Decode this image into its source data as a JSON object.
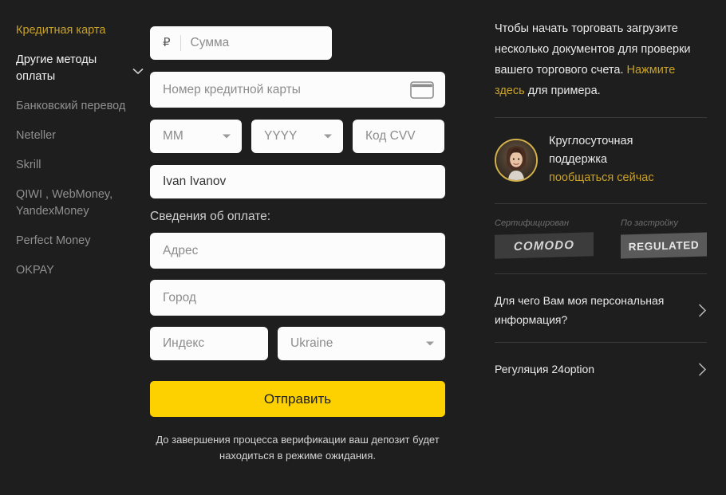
{
  "sidebar": {
    "items": [
      {
        "label": "Кредитная карта",
        "state": "active"
      },
      {
        "label": "Другие методы оплаты",
        "state": "bright",
        "icon": "chevron-down-icon"
      },
      {
        "label": "Банковский перевод",
        "state": "normal"
      },
      {
        "label": "Neteller",
        "state": "normal"
      },
      {
        "label": "Skrill",
        "state": "normal"
      },
      {
        "label": "QIWI , WebMoney, YandexMoney",
        "state": "normal"
      },
      {
        "label": "Perfect Money",
        "state": "normal"
      },
      {
        "label": "OKPAY",
        "state": "normal"
      }
    ]
  },
  "form": {
    "amount": {
      "currency_symbol": "₽",
      "placeholder": "Сумма",
      "value": ""
    },
    "card_number": {
      "placeholder": "Номер кредитной карты",
      "value": "",
      "icon": "credit-card-icon"
    },
    "month": {
      "value": "MM"
    },
    "year": {
      "value": "YYYY"
    },
    "cvv": {
      "placeholder": "Код CVV",
      "value": ""
    },
    "cardholder": {
      "value": "Ivan Ivanov",
      "placeholder": ""
    },
    "billing_label": "Сведения об оплате:",
    "address": {
      "placeholder": "Адрес",
      "value": ""
    },
    "city": {
      "placeholder": "Город",
      "value": ""
    },
    "zip": {
      "placeholder": "Индекс",
      "value": ""
    },
    "country": {
      "value": "Ukraine"
    },
    "submit_label": "Отправить",
    "disclaimer": "До завершения процесса верификации ваш депозит будет находиться в режиме ожидания."
  },
  "right": {
    "promo_text": "Чтобы начать торговать загрузите несколько документов для проверки вашего торгового счета. ",
    "promo_link": "Нажмите здесь",
    "promo_tail": " для примера.",
    "support": {
      "title_line1": "Круглосуточная",
      "title_line2": "поддержка",
      "chat_link": "пообщаться сейчас",
      "avatar": "support-agent-avatar"
    },
    "badges": [
      {
        "caption": "Сертифицирован",
        "label": "COMODO"
      },
      {
        "caption": "По застройку",
        "label": "REGULATED"
      }
    ],
    "links": [
      {
        "label": "Для чего Вам моя персональная информация?",
        "icon": "chevron-right-icon"
      },
      {
        "label": "Регуляция 24option",
        "icon": "chevron-right-icon"
      }
    ]
  },
  "colors": {
    "background": "#1e1e1e",
    "accent_gold": "#c9a227",
    "submit_yellow": "#fdd000",
    "field_white": "#fcfcfc",
    "text_light": "#eaeaea",
    "text_muted": "#8f8f8f"
  }
}
